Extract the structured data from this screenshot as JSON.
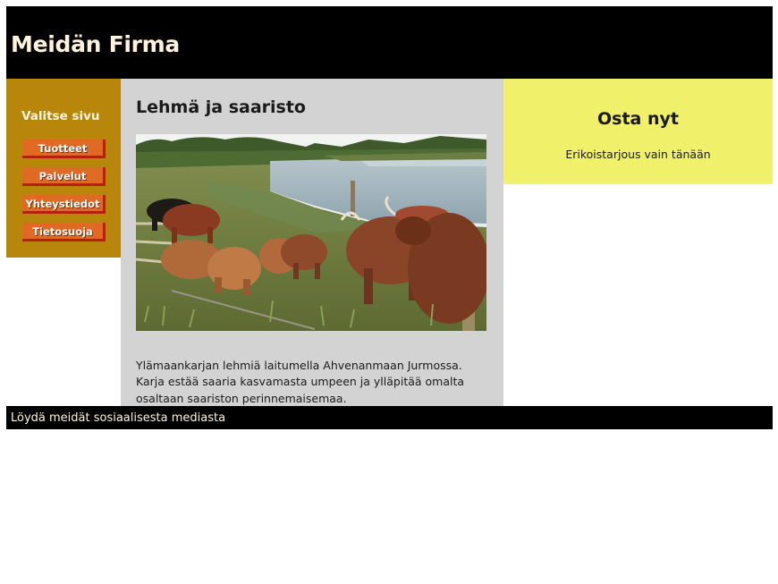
{
  "header": {
    "title": "Meidän Firma"
  },
  "sidebar": {
    "heading": "Valitse sivu",
    "items": [
      {
        "label": "Tuotteet"
      },
      {
        "label": "Palvelut"
      },
      {
        "label": "Yhteystiedot"
      },
      {
        "label": "Tietosuoja"
      }
    ]
  },
  "main": {
    "title": "Lehmä ja saaristo",
    "image_icon": "highland-cattle-photo",
    "caption": "Ylämaankarjan lehmiä laitumella Ahvenanmaan Jurmossa. Karja estää saaria kasvamasta umpeen ja ylläpitää omalta osaltaan saariston perinnemaisemaa."
  },
  "aside": {
    "title": "Osta nyt",
    "text": "Erikoistarjous vain tänään"
  },
  "footer": {
    "text": "Löydä meidät sosiaalisesta mediasta"
  },
  "colors": {
    "header_bg": "#000000",
    "sidebar_bg": "#b8860b",
    "button_bg": "#e06a23",
    "main_bg": "#d3d3d3",
    "aside_bg": "#f0f06a"
  }
}
